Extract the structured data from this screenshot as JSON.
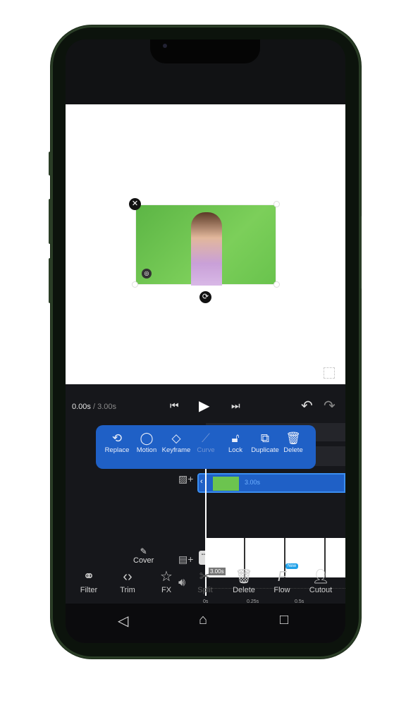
{
  "player": {
    "current_time": "0.00s",
    "separator": "/",
    "total_time": "3.00s",
    "prev_icon": "skip-previous-icon",
    "play_icon": "play-icon",
    "next_icon": "skip-next-icon",
    "undo_icon": "undo-icon",
    "redo_icon": "redo-icon"
  },
  "context_menu": [
    {
      "label": "Replace",
      "icon": "⟲",
      "enabled": true
    },
    {
      "label": "Motion",
      "icon": "◯",
      "enabled": true
    },
    {
      "label": "Keyframe",
      "icon": "◇",
      "enabled": true
    },
    {
      "label": "Curve",
      "icon": "⟋",
      "enabled": false
    },
    {
      "label": "Lock",
      "icon": "🔓︎",
      "enabled": true
    },
    {
      "label": "Duplicate",
      "icon": "⧉",
      "enabled": true
    },
    {
      "label": "Delete",
      "icon": "🗑︎",
      "enabled": true
    }
  ],
  "timeline": {
    "overlay_clip_duration": "3.00s",
    "main_clip_duration": "3.00s",
    "cover_label": "Cover",
    "ticks": [
      "0s",
      "0.25s",
      "0.5s"
    ],
    "accent": "#1f60c6"
  },
  "toolbar": [
    {
      "label": "Filter",
      "icon": "⚭",
      "enabled": true
    },
    {
      "label": "Trim",
      "icon": "‹›",
      "enabled": true
    },
    {
      "label": "FX",
      "icon": "☆",
      "enabled": true
    },
    {
      "label": "Split",
      "icon": "✂",
      "enabled": false
    },
    {
      "label": "Delete",
      "icon": "🗑︎",
      "enabled": true
    },
    {
      "label": "Flow",
      "icon": "F",
      "enabled": true,
      "badge": "New"
    },
    {
      "label": "Cutout",
      "icon": "👤︎",
      "enabled": true
    }
  ]
}
